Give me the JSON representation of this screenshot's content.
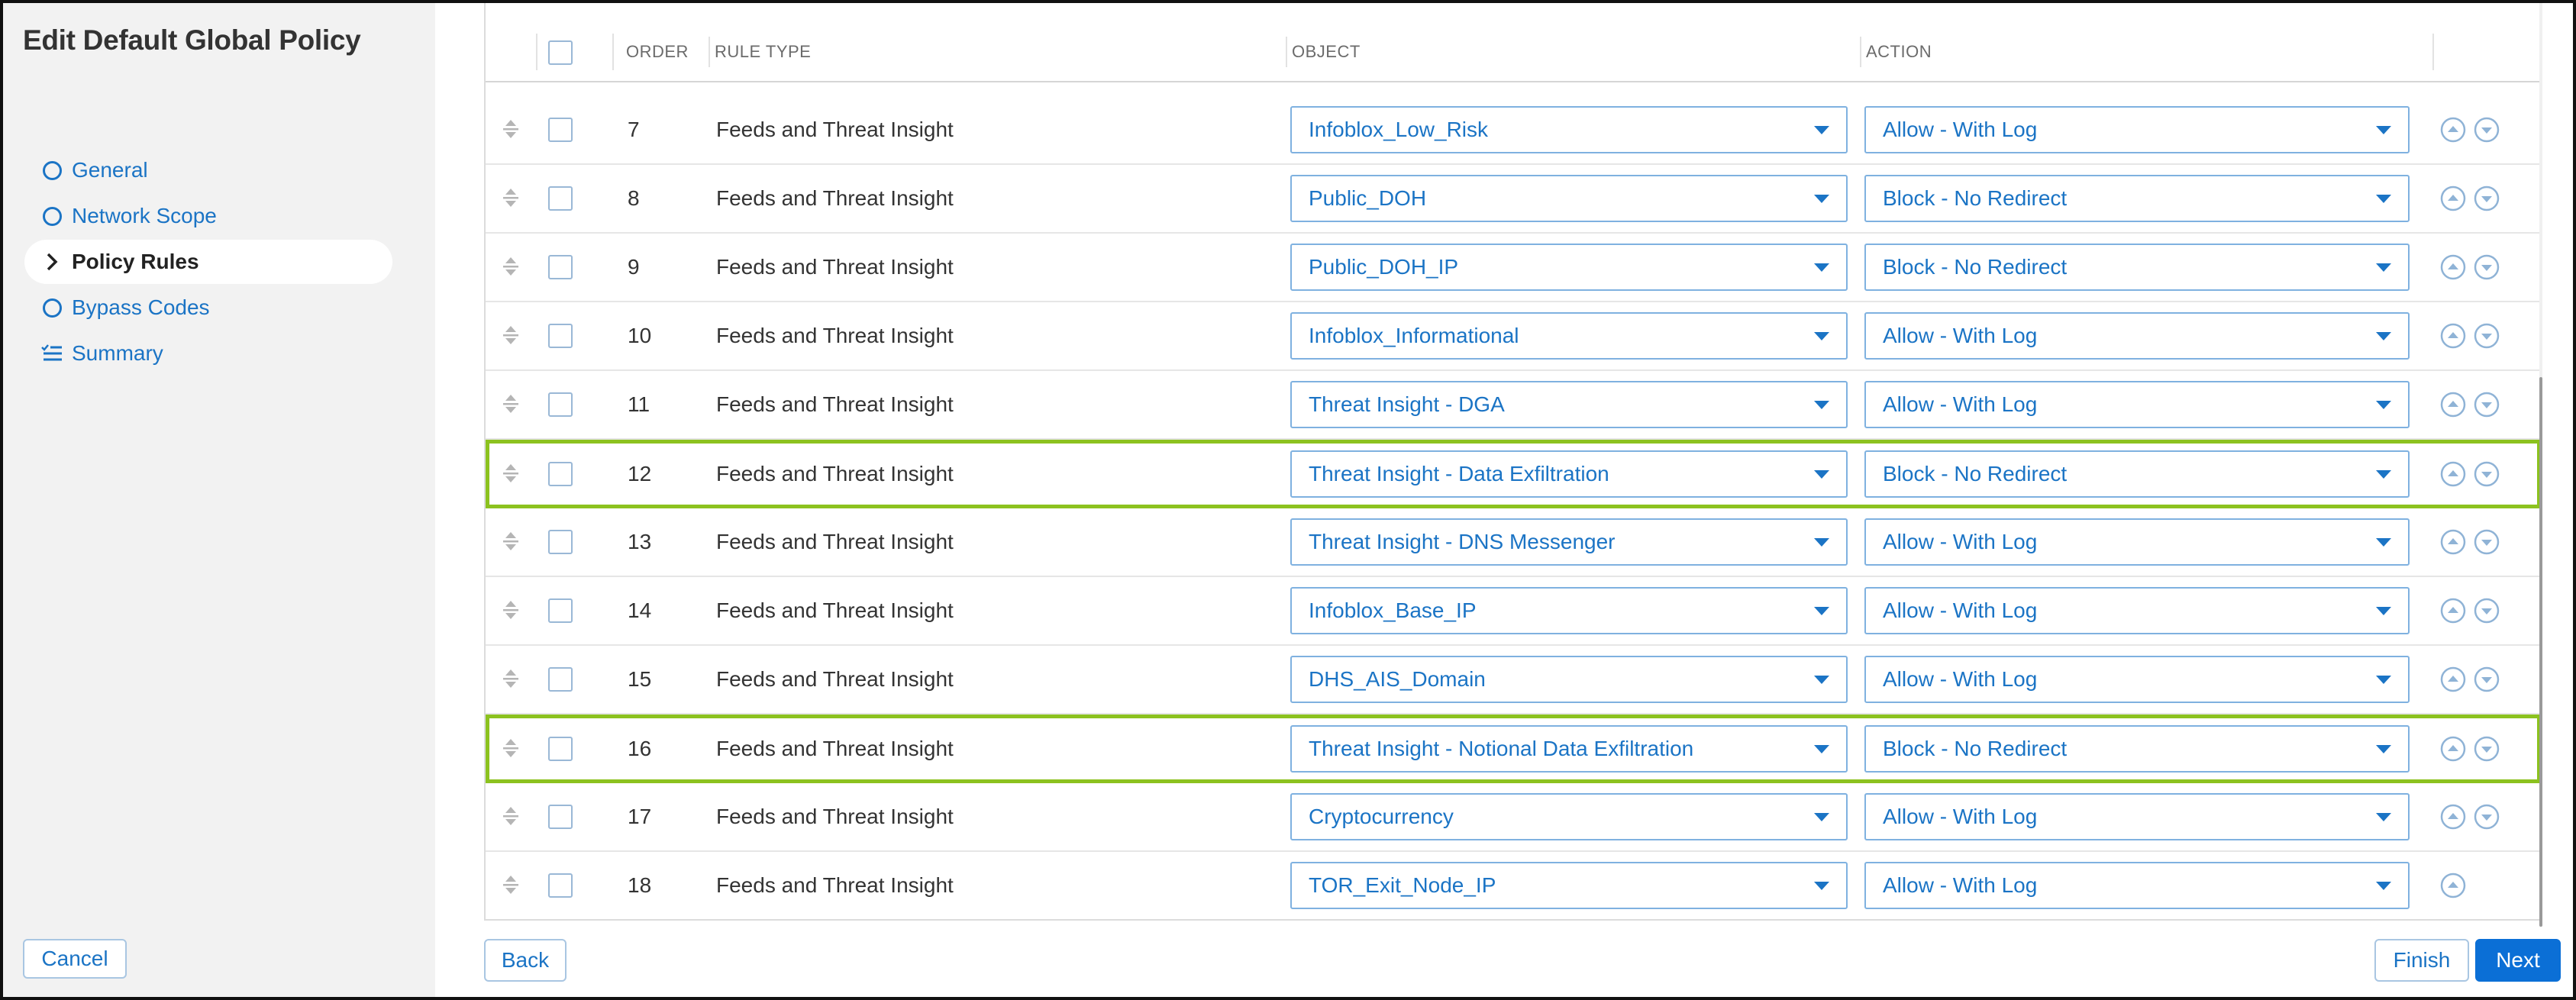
{
  "page": {
    "title": "Edit Default Global Policy"
  },
  "nav": [
    {
      "label": "General",
      "icon": "circle-icon",
      "active": false
    },
    {
      "label": "Network Scope",
      "icon": "circle-icon",
      "active": false
    },
    {
      "label": "Policy Rules",
      "icon": "chevron-right-icon",
      "active": true
    },
    {
      "label": "Bypass Codes",
      "icon": "circle-icon",
      "active": false
    },
    {
      "label": "Summary",
      "icon": "checklist-icon",
      "active": false
    }
  ],
  "table": {
    "headers": {
      "order": "ORDER",
      "rule_type": "RULE TYPE",
      "object": "OBJECT",
      "action": "ACTION"
    },
    "rows": [
      {
        "order": "7",
        "rule_type": "Feeds and Threat Insight",
        "object": "Infoblox_Low_Risk",
        "action": "Allow - With Log",
        "highlighted": false,
        "move_down": true
      },
      {
        "order": "8",
        "rule_type": "Feeds and Threat Insight",
        "object": "Public_DOH",
        "action": "Block - No Redirect",
        "highlighted": false,
        "move_down": true
      },
      {
        "order": "9",
        "rule_type": "Feeds and Threat Insight",
        "object": "Public_DOH_IP",
        "action": "Block - No Redirect",
        "highlighted": false,
        "move_down": true
      },
      {
        "order": "10",
        "rule_type": "Feeds and Threat Insight",
        "object": "Infoblox_Informational",
        "action": "Allow - With Log",
        "highlighted": false,
        "move_down": true
      },
      {
        "order": "11",
        "rule_type": "Feeds and Threat Insight",
        "object": "Threat Insight - DGA",
        "action": "Allow - With Log",
        "highlighted": false,
        "move_down": true
      },
      {
        "order": "12",
        "rule_type": "Feeds and Threat Insight",
        "object": "Threat Insight - Data Exfiltration",
        "action": "Block - No Redirect",
        "highlighted": true,
        "move_down": true
      },
      {
        "order": "13",
        "rule_type": "Feeds and Threat Insight",
        "object": "Threat Insight - DNS Messenger",
        "action": "Allow - With Log",
        "highlighted": false,
        "move_down": true
      },
      {
        "order": "14",
        "rule_type": "Feeds and Threat Insight",
        "object": "Infoblox_Base_IP",
        "action": "Allow - With Log",
        "highlighted": false,
        "move_down": true
      },
      {
        "order": "15",
        "rule_type": "Feeds and Threat Insight",
        "object": "DHS_AIS_Domain",
        "action": "Allow - With Log",
        "highlighted": false,
        "move_down": true
      },
      {
        "order": "16",
        "rule_type": "Feeds and Threat Insight",
        "object": "Threat Insight - Notional Data Exfiltration",
        "action": "Block - No Redirect",
        "highlighted": true,
        "move_down": true
      },
      {
        "order": "17",
        "rule_type": "Feeds and Threat Insight",
        "object": "Cryptocurrency",
        "action": "Allow - With Log",
        "highlighted": false,
        "move_down": true
      },
      {
        "order": "18",
        "rule_type": "Feeds and Threat Insight",
        "object": "TOR_Exit_Node_IP",
        "action": "Allow - With Log",
        "highlighted": false,
        "move_down": false
      }
    ]
  },
  "buttons": {
    "cancel": "Cancel",
    "back": "Back",
    "finish": "Finish",
    "next": "Next"
  },
  "colors": {
    "accent": "#1b74c5",
    "primary": "#0b6fd6",
    "highlight": "#8cc21f",
    "sidebar_bg": "#f2f2f2"
  }
}
